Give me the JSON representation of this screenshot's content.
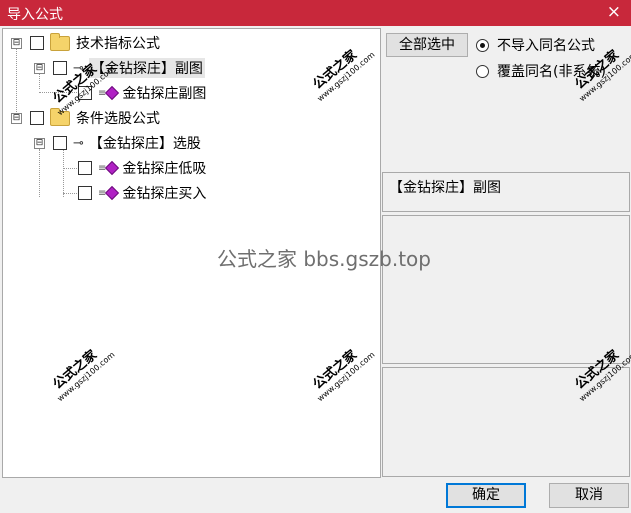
{
  "window": {
    "title": "导入公式",
    "close_glyph": "×"
  },
  "tree": {
    "nodes": [
      {
        "label": "技术指标公式",
        "icon": "folder-icon",
        "checked": false,
        "expander": "⊟"
      },
      {
        "label": "【金钻探庄】副图",
        "icon": "key-icon",
        "checked": false,
        "expander": "⊟",
        "selected": true
      },
      {
        "label": "金钻探庄副图",
        "icon": "gem-icon",
        "checked": false
      },
      {
        "label": "条件选股公式",
        "icon": "folder-icon",
        "checked": false,
        "expander": "⊟"
      },
      {
        "label": "【金钻探庄】选股",
        "icon": "key-icon",
        "checked": false,
        "expander": "⊟"
      },
      {
        "label": "金钻探庄低吸",
        "icon": "gem-icon",
        "checked": false
      },
      {
        "label": "金钻探庄买入",
        "icon": "gem-icon",
        "checked": false
      }
    ]
  },
  "right": {
    "select_all_label": "全部选中",
    "radio_skip_label": "不导入同名公式",
    "radio_overwrite_label": "覆盖同名(非系统)",
    "radio_selected": "skip",
    "info_text": "【金钻探庄】副图"
  },
  "footer": {
    "ok_label": "确定",
    "cancel_label": "取消"
  },
  "watermark": {
    "brand": "公式之家",
    "url": "www.gszj100.com",
    "center_text": "公式之家 bbs.gszb.top"
  },
  "colors": {
    "titlebar": "#c8283b",
    "gem": "#b021c4",
    "folder": "#f5d36a"
  }
}
